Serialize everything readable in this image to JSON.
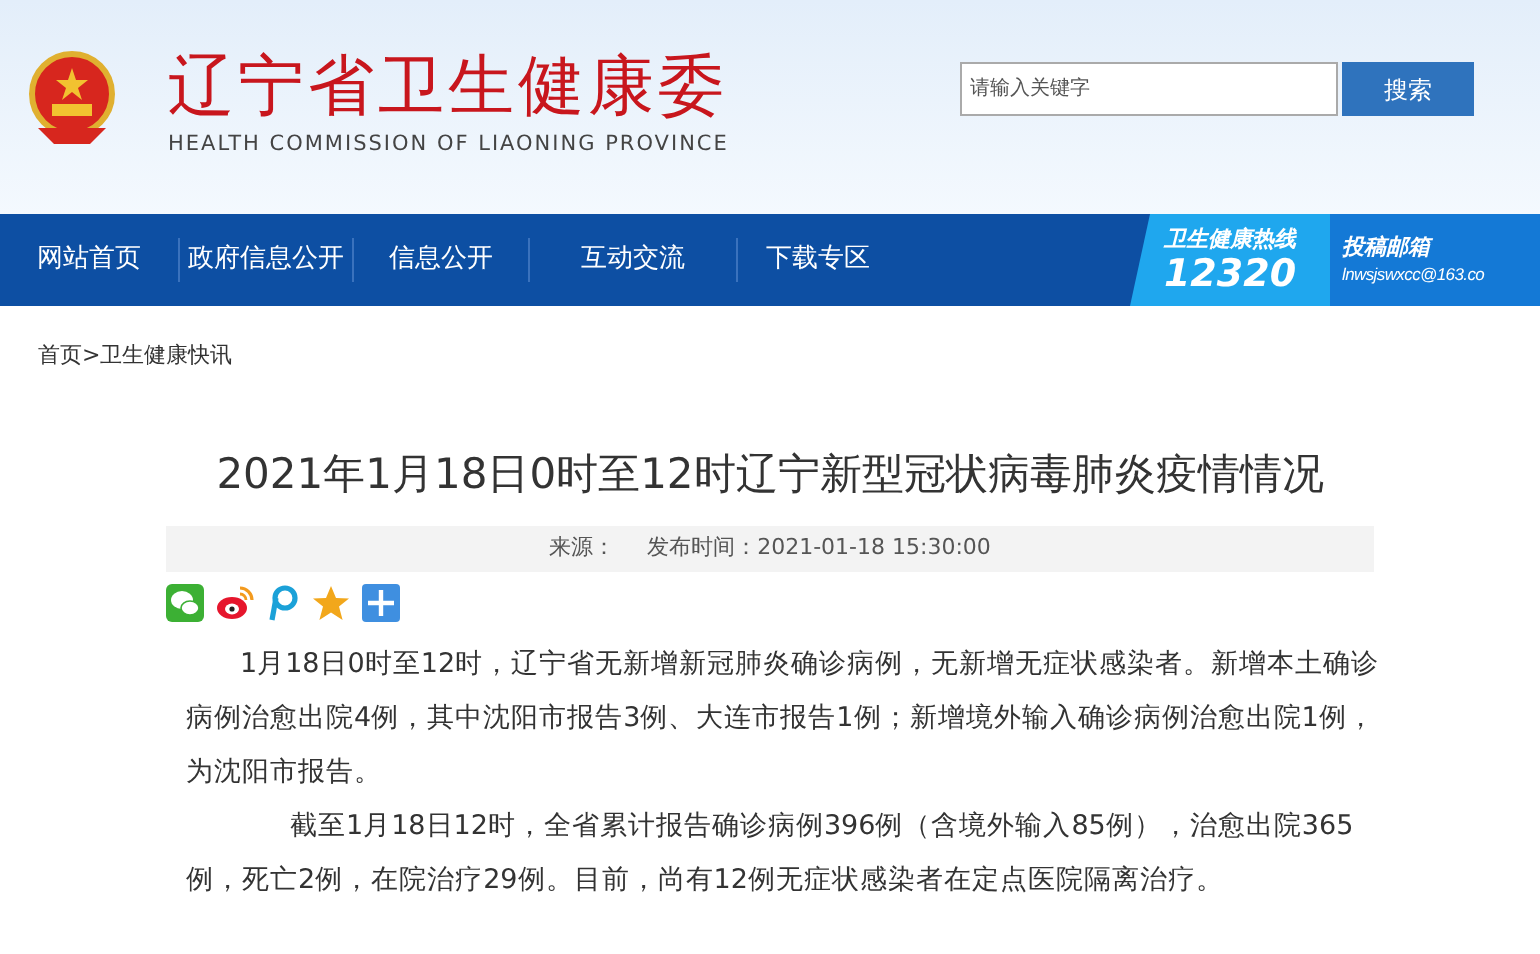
{
  "header": {
    "site_title": "辽宁省卫生健康委",
    "site_subtitle": "HEALTH COMMISSION OF LIAONING PROVINCE",
    "search": {
      "placeholder": "请输入关键字",
      "button": "搜索"
    }
  },
  "nav": {
    "items": [
      {
        "label": "网站首页"
      },
      {
        "label": "政府信息公开"
      },
      {
        "label": "信息公开"
      },
      {
        "label": "互动交流"
      },
      {
        "label": "下载专区"
      }
    ],
    "hotline": {
      "label": "卫生健康热线",
      "number": "12320"
    },
    "mailbox": {
      "label": "投稿邮箱",
      "address": "lnwsjswxcc@163.co"
    }
  },
  "breadcrumb": [
    "首页",
    ">",
    "卫生健康快讯"
  ],
  "article": {
    "title": "2021年1月18日0时至12时辽宁新型冠状病毒肺炎疫情情况",
    "source_label": "来源：",
    "published": "发布时间：2021-01-18 15:30:00",
    "share_icons": [
      {
        "kind": "wechat"
      },
      {
        "kind": "weibo"
      },
      {
        "kind": "pengyou"
      },
      {
        "kind": "qzone"
      },
      {
        "kind": "more"
      }
    ],
    "paragraphs": [
      "1月18日0时至12时，辽宁省无新增新冠肺炎确诊病例，无新增无症状感染者。新增本土确诊病例治愈出院4例，其中沈阳市报告3例、大连市报告1例；新增境外输入确诊病例治愈出院1例，为沈阳市报告。",
      "截至1月18日12时，全省累计报告确诊病例396例（含境外输入85例），治愈出院365例，死亡2例，在院治疗29例。目前，尚有12例无症状感染者在定点医院隔离治疗。"
    ]
  }
}
